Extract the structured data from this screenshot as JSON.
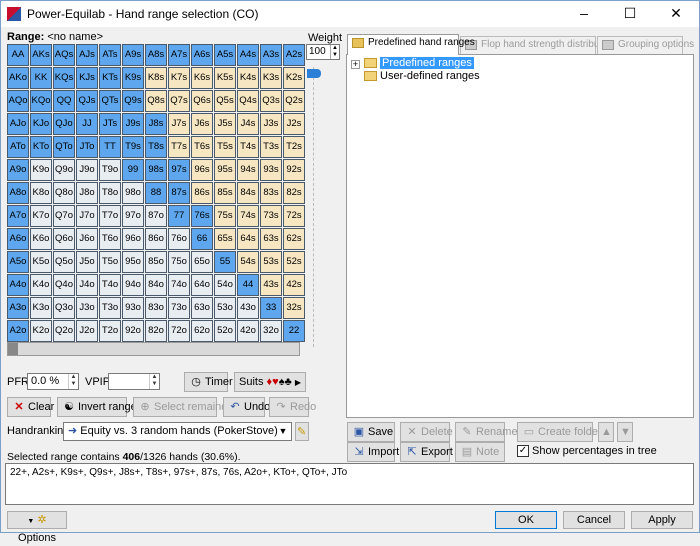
{
  "window": {
    "title": "Power-Equilab - Hand range selection (CO)",
    "minimize": "–",
    "maximize": "☐",
    "close": "✕"
  },
  "range": {
    "label": "Range:",
    "name": "<no name>"
  },
  "grid": {
    "rows": [
      [
        [
          "AA",
          "sel"
        ],
        [
          "AKs",
          "sel"
        ],
        [
          "AQs",
          "sel"
        ],
        [
          "AJs",
          "sel"
        ],
        [
          "ATs",
          "sel"
        ],
        [
          "A9s",
          "sel"
        ],
        [
          "A8s",
          "sel"
        ],
        [
          "A7s",
          "sel"
        ],
        [
          "A6s",
          "sel"
        ],
        [
          "A5s",
          "sel"
        ],
        [
          "A4s",
          "sel"
        ],
        [
          "A3s",
          "sel"
        ],
        [
          "A2s",
          "sel"
        ]
      ],
      [
        [
          "AKo",
          "sel"
        ],
        [
          "KK",
          "sel"
        ],
        [
          "KQs",
          "sel"
        ],
        [
          "KJs",
          "sel"
        ],
        [
          "KTs",
          "sel"
        ],
        [
          "K9s",
          "sel"
        ],
        [
          "K8s",
          "suit"
        ],
        [
          "K7s",
          "suit"
        ],
        [
          "K6s",
          "suit"
        ],
        [
          "K5s",
          "suit"
        ],
        [
          "K4s",
          "suit"
        ],
        [
          "K3s",
          "suit"
        ],
        [
          "K2s",
          "suit"
        ]
      ],
      [
        [
          "AQo",
          "sel"
        ],
        [
          "KQo",
          "sel"
        ],
        [
          "QQ",
          "sel"
        ],
        [
          "QJs",
          "sel"
        ],
        [
          "QTs",
          "sel"
        ],
        [
          "Q9s",
          "sel"
        ],
        [
          "Q8s",
          "suit"
        ],
        [
          "Q7s",
          "suit"
        ],
        [
          "Q6s",
          "suit"
        ],
        [
          "Q5s",
          "suit"
        ],
        [
          "Q4s",
          "suit"
        ],
        [
          "Q3s",
          "suit"
        ],
        [
          "Q2s",
          "suit"
        ]
      ],
      [
        [
          "AJo",
          "sel"
        ],
        [
          "KJo",
          "sel"
        ],
        [
          "QJo",
          "sel"
        ],
        [
          "JJ",
          "sel"
        ],
        [
          "JTs",
          "sel"
        ],
        [
          "J9s",
          "sel"
        ],
        [
          "J8s",
          "sel"
        ],
        [
          "J7s",
          "suit"
        ],
        [
          "J6s",
          "suit"
        ],
        [
          "J5s",
          "suit"
        ],
        [
          "J4s",
          "suit"
        ],
        [
          "J3s",
          "suit"
        ],
        [
          "J2s",
          "suit"
        ]
      ],
      [
        [
          "ATo",
          "sel"
        ],
        [
          "KTo",
          "sel"
        ],
        [
          "QTo",
          "sel"
        ],
        [
          "JTo",
          "sel"
        ],
        [
          "TT",
          "sel"
        ],
        [
          "T9s",
          "sel"
        ],
        [
          "T8s",
          "sel"
        ],
        [
          "T7s",
          "suit"
        ],
        [
          "T6s",
          "suit"
        ],
        [
          "T5s",
          "suit"
        ],
        [
          "T4s",
          "suit"
        ],
        [
          "T3s",
          "suit"
        ],
        [
          "T2s",
          "suit"
        ]
      ],
      [
        [
          "A9o",
          "sel"
        ],
        [
          "K9o",
          "off"
        ],
        [
          "Q9o",
          "off"
        ],
        [
          "J9o",
          "off"
        ],
        [
          "T9o",
          "off"
        ],
        [
          "99",
          "sel"
        ],
        [
          "98s",
          "sel"
        ],
        [
          "97s",
          "sel"
        ],
        [
          "96s",
          "suit"
        ],
        [
          "95s",
          "suit"
        ],
        [
          "94s",
          "suit"
        ],
        [
          "93s",
          "suit"
        ],
        [
          "92s",
          "suit"
        ]
      ],
      [
        [
          "A8o",
          "sel"
        ],
        [
          "K8o",
          "off"
        ],
        [
          "Q8o",
          "off"
        ],
        [
          "J8o",
          "off"
        ],
        [
          "T8o",
          "off"
        ],
        [
          "98o",
          "off"
        ],
        [
          "88",
          "sel"
        ],
        [
          "87s",
          "sel"
        ],
        [
          "86s",
          "suit"
        ],
        [
          "85s",
          "suit"
        ],
        [
          "84s",
          "suit"
        ],
        [
          "83s",
          "suit"
        ],
        [
          "82s",
          "suit"
        ]
      ],
      [
        [
          "A7o",
          "sel"
        ],
        [
          "K7o",
          "off"
        ],
        [
          "Q7o",
          "off"
        ],
        [
          "J7o",
          "off"
        ],
        [
          "T7o",
          "off"
        ],
        [
          "97o",
          "off"
        ],
        [
          "87o",
          "off"
        ],
        [
          "77",
          "sel"
        ],
        [
          "76s",
          "sel"
        ],
        [
          "75s",
          "suit"
        ],
        [
          "74s",
          "suit"
        ],
        [
          "73s",
          "suit"
        ],
        [
          "72s",
          "suit"
        ]
      ],
      [
        [
          "A6o",
          "sel"
        ],
        [
          "K6o",
          "off"
        ],
        [
          "Q6o",
          "off"
        ],
        [
          "J6o",
          "off"
        ],
        [
          "T6o",
          "off"
        ],
        [
          "96o",
          "off"
        ],
        [
          "86o",
          "off"
        ],
        [
          "76o",
          "off"
        ],
        [
          "66",
          "sel"
        ],
        [
          "65s",
          "suit"
        ],
        [
          "64s",
          "suit"
        ],
        [
          "63s",
          "suit"
        ],
        [
          "62s",
          "suit"
        ]
      ],
      [
        [
          "A5o",
          "sel"
        ],
        [
          "K5o",
          "off"
        ],
        [
          "Q5o",
          "off"
        ],
        [
          "J5o",
          "off"
        ],
        [
          "T5o",
          "off"
        ],
        [
          "95o",
          "off"
        ],
        [
          "85o",
          "off"
        ],
        [
          "75o",
          "off"
        ],
        [
          "65o",
          "off"
        ],
        [
          "55",
          "sel"
        ],
        [
          "54s",
          "suit"
        ],
        [
          "53s",
          "suit"
        ],
        [
          "52s",
          "suit"
        ]
      ],
      [
        [
          "A4o",
          "sel"
        ],
        [
          "K4o",
          "off"
        ],
        [
          "Q4o",
          "off"
        ],
        [
          "J4o",
          "off"
        ],
        [
          "T4o",
          "off"
        ],
        [
          "94o",
          "off"
        ],
        [
          "84o",
          "off"
        ],
        [
          "74o",
          "off"
        ],
        [
          "64o",
          "off"
        ],
        [
          "54o",
          "off"
        ],
        [
          "44",
          "sel"
        ],
        [
          "43s",
          "suit"
        ],
        [
          "42s",
          "suit"
        ]
      ],
      [
        [
          "A3o",
          "sel"
        ],
        [
          "K3o",
          "off"
        ],
        [
          "Q3o",
          "off"
        ],
        [
          "J3o",
          "off"
        ],
        [
          "T3o",
          "off"
        ],
        [
          "93o",
          "off"
        ],
        [
          "83o",
          "off"
        ],
        [
          "73o",
          "off"
        ],
        [
          "63o",
          "off"
        ],
        [
          "53o",
          "off"
        ],
        [
          "43o",
          "off"
        ],
        [
          "33",
          "sel"
        ],
        [
          "32s",
          "suit"
        ]
      ],
      [
        [
          "A2o",
          "sel"
        ],
        [
          "K2o",
          "off"
        ],
        [
          "Q2o",
          "off"
        ],
        [
          "J2o",
          "off"
        ],
        [
          "T2o",
          "off"
        ],
        [
          "92o",
          "off"
        ],
        [
          "82o",
          "off"
        ],
        [
          "72o",
          "off"
        ],
        [
          "62o",
          "off"
        ],
        [
          "52o",
          "off"
        ],
        [
          "42o",
          "off"
        ],
        [
          "32o",
          "off"
        ],
        [
          "22",
          "sel"
        ]
      ]
    ]
  },
  "weight": {
    "label": "Weight",
    "value": "100"
  },
  "pfr": {
    "label": "PFR:",
    "value": "0.0 %"
  },
  "vpip": {
    "label": "VPIP:",
    "value": ""
  },
  "buttons": {
    "timer": "Timer",
    "suits": "Suits",
    "clear": "Clear",
    "invert": "Invert range",
    "select_remainder": "Select remainder",
    "undo": "Undo",
    "redo": "Redo",
    "save": "Save",
    "delete": "Delete",
    "rename": "Rename",
    "create_folder": "Create folder",
    "import": "Import",
    "export": "Export",
    "note": "Note",
    "options": "Options",
    "ok": "OK",
    "cancel": "Cancel",
    "apply": "Apply"
  },
  "handranking": {
    "label": "Handranking:",
    "value": "Equity vs. 3 random hands (PokerStove)"
  },
  "summary": {
    "prefix": "Selected range contains ",
    "selected": "406",
    "suffix": "/1326 hands (30.6%)."
  },
  "range_text": "22+, A2s+, K9s+, Q9s+, J8s+, T8s+, 97s+, 87s, 76s, A2o+, KTo+, QTo+, JTo",
  "tabs": [
    "Predefined hand ranges",
    "Flop hand strength distribution",
    "Grouping options"
  ],
  "tree": {
    "node1": "Predefined ranges",
    "node2": "User-defined ranges"
  },
  "show_percentages": "Show percentages in tree"
}
